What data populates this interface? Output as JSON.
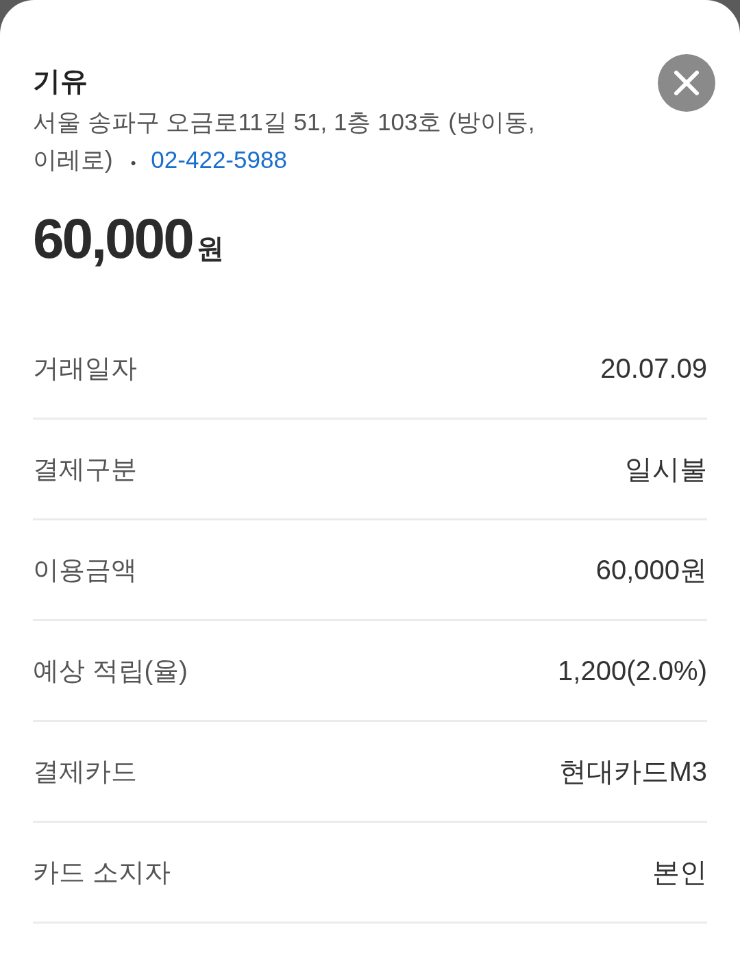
{
  "merchant": {
    "name": "기유",
    "address": "서울 송파구 오금로11길 51, 1층 103호 (방이동, 이레로)",
    "separator": "•",
    "phone": "02-422-5988"
  },
  "amount": {
    "value": "60,000",
    "unit": "원"
  },
  "details": [
    {
      "label": "거래일자",
      "value": "20.07.09"
    },
    {
      "label": "결제구분",
      "value": "일시불"
    },
    {
      "label": "이용금액",
      "value": "60,000원"
    },
    {
      "label": "예상 적립(율)",
      "value": "1,200(2.0%)"
    },
    {
      "label": "결제카드",
      "value": "현대카드M3"
    },
    {
      "label": "카드 소지자",
      "value": "본인"
    }
  ]
}
